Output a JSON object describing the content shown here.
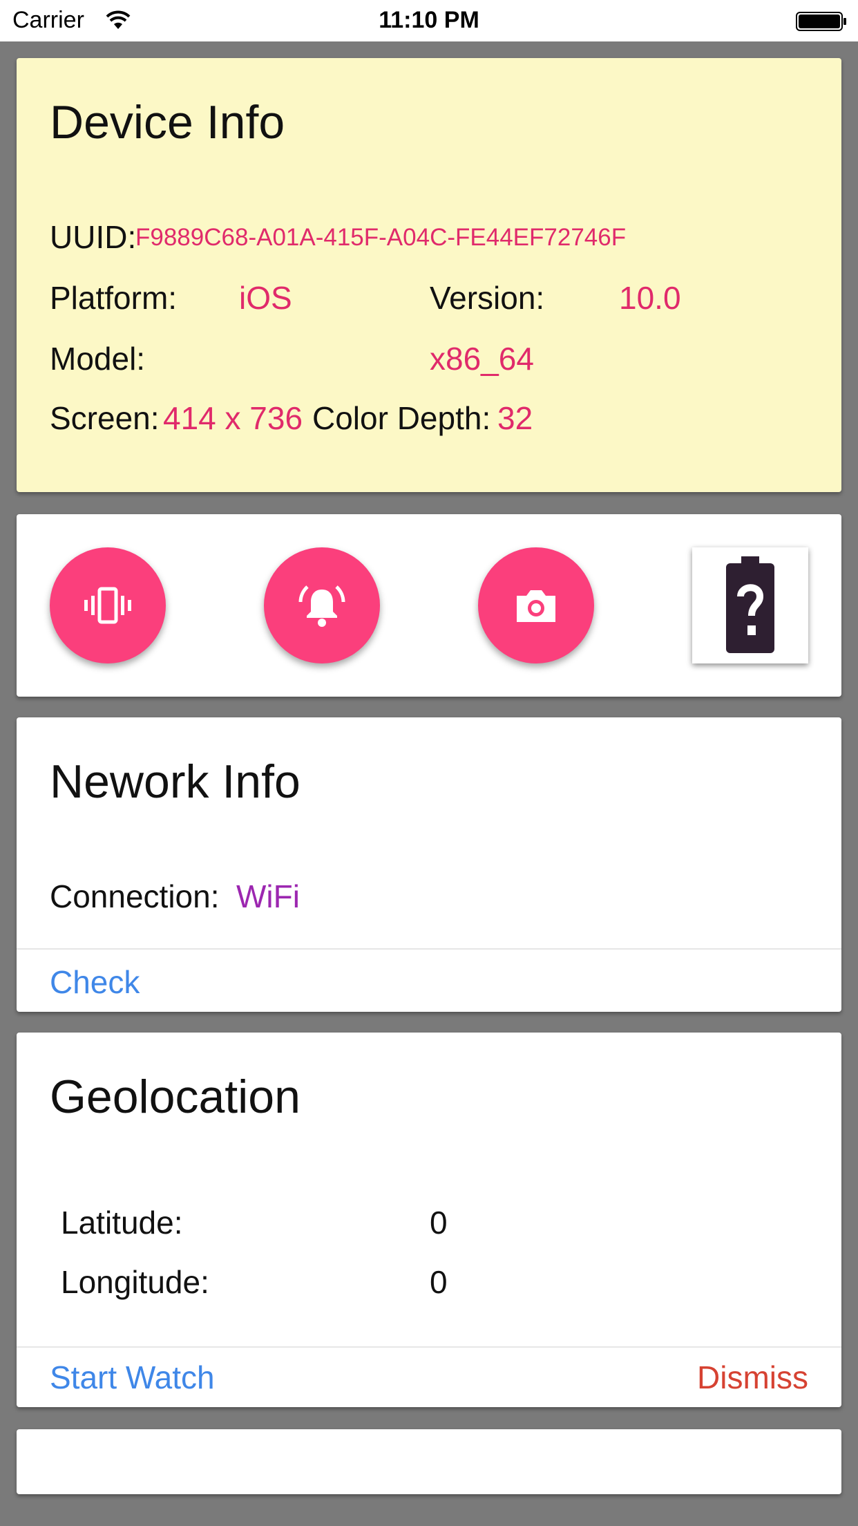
{
  "status_bar": {
    "carrier": "Carrier",
    "time": "11:10 PM",
    "wifi_icon": "wifi-icon",
    "battery_icon": "battery-full-icon"
  },
  "device_info": {
    "title": "Device Info",
    "uuid_label": "UUID:",
    "uuid_value": "F9889C68-A01A-415F-A04C-FE44EF72746F",
    "platform_label": "Platform:",
    "platform_value": "iOS",
    "version_label": "Version:",
    "version_value": "10.0",
    "model_label": "Model:",
    "model_value": "x86_64",
    "screen_label": "Screen:",
    "screen_value": "414 x 736",
    "color_depth_label": "Color Depth:",
    "color_depth_value": "32",
    "background": "#fcf8c6"
  },
  "actions": {
    "buttons": [
      {
        "icon": "vibrate-icon"
      },
      {
        "icon": "alarm-bell-icon"
      },
      {
        "icon": "camera-icon"
      },
      {
        "icon": "battery-unknown-icon"
      }
    ],
    "accent": "#fb3f7c"
  },
  "network_info": {
    "title": "Nework Info",
    "connection_label": "Connection:",
    "connection_value": "WiFi",
    "check_label": "Check"
  },
  "geolocation": {
    "title": "Geolocation",
    "latitude_label": "Latitude:",
    "latitude_value": "0",
    "longitude_label": "Longitude:",
    "longitude_value": "0",
    "start_watch_label": "Start Watch",
    "dismiss_label": "Dismiss"
  },
  "colors": {
    "value_pink": "#e02a6b",
    "value_purple": "#9c27b0",
    "link_blue": "#3f87e8",
    "dismiss_red": "#d64232"
  }
}
